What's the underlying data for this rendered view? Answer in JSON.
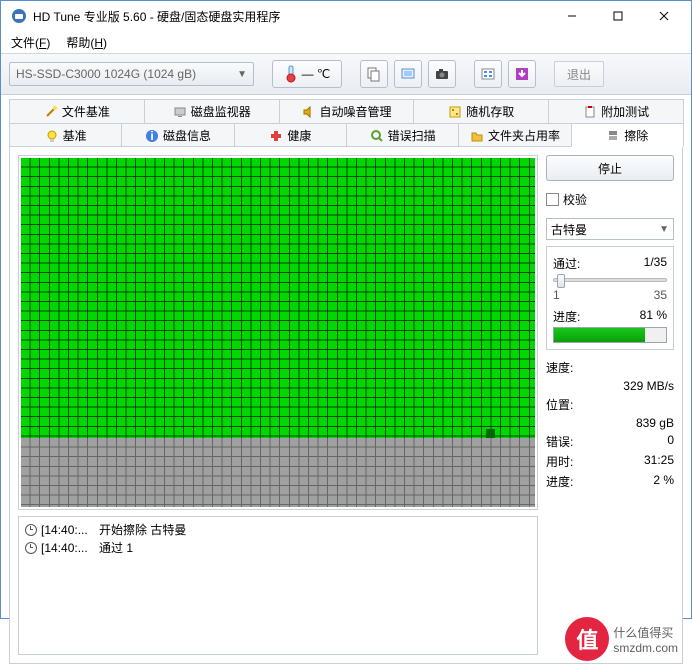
{
  "window": {
    "title": "HD Tune 专业版 5.60 - 硬盘/固态硬盘实用程序"
  },
  "menu": {
    "file": "文件",
    "file_key": "F",
    "help": "帮助",
    "help_key": "H"
  },
  "toolbar": {
    "drive": "HS-SSD-C3000 1024G (1024 gB)",
    "temp": "— ℃",
    "exit": "退出"
  },
  "tabs_top": [
    {
      "label": "文件基准"
    },
    {
      "label": "磁盘监视器"
    },
    {
      "label": "自动噪音管理"
    },
    {
      "label": "随机存取"
    },
    {
      "label": "附加测试"
    }
  ],
  "tabs_bottom": [
    {
      "label": "基准"
    },
    {
      "label": "磁盘信息"
    },
    {
      "label": "健康"
    },
    {
      "label": "错误扫描"
    },
    {
      "label": "文件夹占用率"
    },
    {
      "label": "擦除"
    }
  ],
  "actions": {
    "stop": "停止"
  },
  "verify": {
    "label": "校验",
    "checked": false
  },
  "method": {
    "selected": "古特曼"
  },
  "pass": {
    "label": "通过:",
    "value": "1/35",
    "min": "1",
    "max": "35"
  },
  "progress": {
    "label": "进度:",
    "value": "81 %",
    "percent": 81
  },
  "stats": {
    "speed_label": "速度:",
    "speed": "329 MB/s",
    "pos_label": "位置:",
    "pos": "839 gB",
    "errors_label": "错误:",
    "errors": "0",
    "time_label": "用时:",
    "time": "31:25",
    "prog2_label": "进度:",
    "prog2": "2 %"
  },
  "log": [
    {
      "time": "[14:40:...",
      "text": "开始擦除 古特曼"
    },
    {
      "time": "[14:40:...",
      "text": "通过 1"
    }
  ],
  "watermark": {
    "char": "值",
    "l1": "什么值得买",
    "l2": "smzdm.com"
  }
}
